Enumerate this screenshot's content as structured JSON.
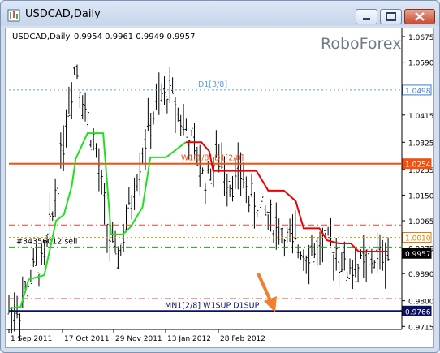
{
  "window": {
    "title": "USDCAD,Daily"
  },
  "chart_header": {
    "symbol": "USDCAD,Daily",
    "quotes": "0.9954 0.9961 0.9949 0.9957"
  },
  "watermark": "RoboForex",
  "colors": {
    "background": "#ffffff",
    "candles": "#000000",
    "green_line": "#20e020",
    "red_line": "#ee0000",
    "level_orange": "#f05010",
    "level_dotted_blue": "#5aa0f0",
    "level_navy": "#0b1060",
    "arrow": "#f08030",
    "dashdot_red": "#e04030",
    "dashdot_green": "#20a020"
  },
  "chart_data": {
    "type": "line",
    "ylim": [
      0.9715,
      1.0715
    ],
    "y_ticks": [
      "1.0675",
      "1.0590",
      "1.0415",
      "1.0325",
      "1.0235",
      "1.0150",
      "1.0065",
      "0.9975",
      "0.9890",
      "0.9800",
      "0.9715"
    ],
    "x_ticks": [
      "1 Sep 2011",
      "17 Oct 2011",
      "29 Nov 2011",
      "13 Jan 2012",
      "28 Feb 2012"
    ],
    "price_labels": [
      {
        "text": "1.0498",
        "value": 1.0498,
        "bg": "#ffffff",
        "fg": "#3a7cd0",
        "border": "#3a7cd0"
      },
      {
        "text": "1.0254",
        "value": 1.0254,
        "bg": "#f05010",
        "fg": "#ffffff",
        "border": "#f05010"
      },
      {
        "text": "1.0010",
        "value": 1.001,
        "bg": "#ffffff",
        "fg": "#e08000",
        "border": "#e08000"
      },
      {
        "text": "0.9957",
        "value": 0.9957,
        "bg": "#000000",
        "fg": "#ffffff",
        "border": "#000000"
      },
      {
        "text": "0.9766",
        "value": 0.9766,
        "bg": "#0b1060",
        "fg": "#ffffff",
        "border": "#0b1060"
      }
    ],
    "levels": [
      {
        "label": "D1[3/8]",
        "value": 1.0498,
        "style": "dotted",
        "color": "#5aa0f0"
      },
      {
        "label": "W1[1/8] D1[2/8]",
        "value": 1.0254,
        "style": "solid",
        "color": "#f05010"
      },
      {
        "label": "",
        "value": 1.0051,
        "style": "dashdot",
        "color": "#e04030"
      },
      {
        "label": "",
        "value": 1.001,
        "style": "dotted",
        "color": "#e0a000"
      },
      {
        "label": "#34356012 sell",
        "value": 0.9978,
        "style": "dashdot",
        "color": "#20a020"
      },
      {
        "label": "",
        "value": 0.9807,
        "style": "dashdot",
        "color": "#e04030"
      },
      {
        "label": "MN1[2/8] W1SUP D1SUP",
        "value": 0.9766,
        "style": "solid",
        "color": "#0b1060"
      }
    ],
    "green_series": {
      "name": "",
      "points": [
        [
          0,
          0.9775
        ],
        [
          0.03,
          0.978
        ],
        [
          0.05,
          0.987
        ],
        [
          0.09,
          0.9885
        ],
        [
          0.12,
          1.0065
        ],
        [
          0.14,
          1.0085
        ],
        [
          0.16,
          1.018
        ],
        [
          0.17,
          1.027
        ],
        [
          0.2,
          1.0355
        ],
        [
          0.24,
          1.0355
        ],
        [
          0.26,
          1.002
        ],
        [
          0.29,
          1.002
        ],
        [
          0.31,
          1.0045
        ],
        [
          0.34,
          1.011
        ],
        [
          0.36,
          1.0275
        ],
        [
          0.4,
          1.0275
        ],
        [
          0.45,
          1.0325
        ]
      ]
    },
    "red_series": {
      "name": "",
      "points": [
        [
          0.45,
          1.0325
        ],
        [
          0.49,
          1.0325
        ],
        [
          0.51,
          1.0295
        ],
        [
          0.52,
          1.023
        ],
        [
          0.56,
          1.023
        ],
        [
          0.63,
          1.023
        ],
        [
          0.66,
          1.0165
        ],
        [
          0.7,
          1.0165
        ],
        [
          0.73,
          1.013
        ],
        [
          0.75,
          1.004
        ],
        [
          0.79,
          1.004
        ],
        [
          0.81,
          1.0
        ],
        [
          0.84,
          0.999
        ],
        [
          0.87,
          0.999
        ],
        [
          0.89,
          0.9963
        ],
        [
          0.94,
          0.9963
        ],
        [
          0.965,
          0.9963
        ]
      ]
    }
  }
}
